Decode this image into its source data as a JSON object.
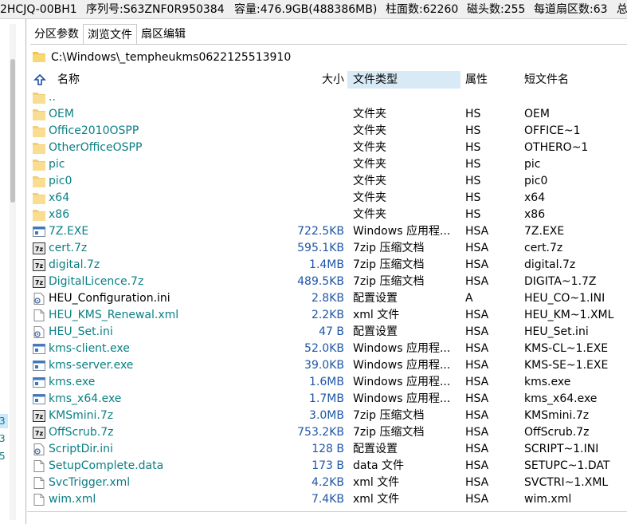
{
  "disk_info": {
    "model": "2HCJQ-00BH1",
    "serial": "序列号:S63ZNF0R950384",
    "capacity": "容量:476.9GB(488386MB)",
    "cylinders": "柱面数:62260",
    "heads": "磁头数:255",
    "sectors": "每道扇区数:63",
    "more": "总"
  },
  "left_pane_fragments": [
    "3",
    "3",
    "5"
  ],
  "tabs": [
    {
      "label": "分区参数",
      "active": false
    },
    {
      "label": "浏览文件",
      "active": true
    },
    {
      "label": "扇区编辑",
      "active": false
    }
  ],
  "path": "C:\\Windows\\_tempheukms0622125513910",
  "columns": {
    "name": "名称",
    "size": "大小",
    "type": "文件类型",
    "attr": "属性",
    "short": "短文件名"
  },
  "colors": {
    "name_text": "#0a7f84",
    "size_text": "#1d56a6",
    "sorted_header_bg": "#d9eaf7",
    "folder": "#f5d27a"
  },
  "files": [
    {
      "icon": "parent-folder-icon",
      "name": "..",
      "size": "",
      "type": "",
      "attr": "",
      "short": ""
    },
    {
      "icon": "folder-icon",
      "name": "OEM",
      "size": "",
      "type": "文件夹",
      "attr": "HS",
      "short": "OEM"
    },
    {
      "icon": "folder-icon",
      "name": "Office2010OSPP",
      "size": "",
      "type": "文件夹",
      "attr": "HS",
      "short": "OFFICE~1"
    },
    {
      "icon": "folder-icon",
      "name": "OtherOfficeOSPP",
      "size": "",
      "type": "文件夹",
      "attr": "HS",
      "short": "OTHERO~1"
    },
    {
      "icon": "folder-icon",
      "name": "pic",
      "size": "",
      "type": "文件夹",
      "attr": "HS",
      "short": "pic"
    },
    {
      "icon": "folder-icon",
      "name": "pic0",
      "size": "",
      "type": "文件夹",
      "attr": "HS",
      "short": "pic0"
    },
    {
      "icon": "folder-icon",
      "name": "x64",
      "size": "",
      "type": "文件夹",
      "attr": "HS",
      "short": "x64"
    },
    {
      "icon": "folder-icon",
      "name": "x86",
      "size": "",
      "type": "文件夹",
      "attr": "HS",
      "short": "x86"
    },
    {
      "icon": "exe-icon",
      "name": "7Z.EXE",
      "size": "722.5KB",
      "type": "Windows 应用程...",
      "attr": "HSA",
      "short": "7Z.EXE"
    },
    {
      "icon": "7z-archive-icon",
      "name": "cert.7z",
      "size": "595.1KB",
      "type": "7zip 压缩文档",
      "attr": "HSA",
      "short": "cert.7z"
    },
    {
      "icon": "7z-archive-icon",
      "name": "digital.7z",
      "size": "1.4MB",
      "type": "7zip 压缩文档",
      "attr": "HSA",
      "short": "digital.7z"
    },
    {
      "icon": "7z-archive-icon",
      "name": "DigitalLicence.7z",
      "size": "489.5KB",
      "type": "7zip 压缩文档",
      "attr": "HSA",
      "short": "DIGITA~1.7Z"
    },
    {
      "icon": "ini-settings-icon",
      "name": "HEU_Configuration.ini",
      "size": "2.8KB",
      "type": "配置设置",
      "attr": "A",
      "short": "HEU_CO~1.INI",
      "plain": true
    },
    {
      "icon": "file-icon",
      "name": "HEU_KMS_Renewal.xml",
      "size": "2.2KB",
      "type": "xml 文件",
      "attr": "HSA",
      "short": "HEU_KM~1.XML"
    },
    {
      "icon": "ini-settings-icon",
      "name": "HEU_Set.ini",
      "size": "47 B",
      "type": "配置设置",
      "attr": "HSA",
      "short": "HEU_Set.ini"
    },
    {
      "icon": "exe-icon",
      "name": "kms-client.exe",
      "size": "52.0KB",
      "type": "Windows 应用程...",
      "attr": "HSA",
      "short": "KMS-CL~1.EXE"
    },
    {
      "icon": "exe-icon",
      "name": "kms-server.exe",
      "size": "39.0KB",
      "type": "Windows 应用程...",
      "attr": "HSA",
      "short": "KMS-SE~1.EXE"
    },
    {
      "icon": "exe-icon",
      "name": "kms.exe",
      "size": "1.6MB",
      "type": "Windows 应用程...",
      "attr": "HSA",
      "short": "kms.exe"
    },
    {
      "icon": "exe-icon",
      "name": "kms_x64.exe",
      "size": "1.7MB",
      "type": "Windows 应用程...",
      "attr": "HSA",
      "short": "kms_x64.exe"
    },
    {
      "icon": "7z-archive-icon",
      "name": "KMSmini.7z",
      "size": "3.0MB",
      "type": "7zip 压缩文档",
      "attr": "HSA",
      "short": "KMSmini.7z"
    },
    {
      "icon": "7z-archive-icon",
      "name": "OffScrub.7z",
      "size": "753.2KB",
      "type": "7zip 压缩文档",
      "attr": "HSA",
      "short": "OffScrub.7z"
    },
    {
      "icon": "ini-settings-icon",
      "name": "ScriptDir.ini",
      "size": "128 B",
      "type": "配置设置",
      "attr": "HSA",
      "short": "SCRIPT~1.INI"
    },
    {
      "icon": "file-icon",
      "name": "SetupComplete.data",
      "size": "173 B",
      "type": "data 文件",
      "attr": "HSA",
      "short": "SETUPC~1.DAT"
    },
    {
      "icon": "file-icon",
      "name": "SvcTrigger.xml",
      "size": "4.2KB",
      "type": "xml 文件",
      "attr": "HSA",
      "short": "SVCTRI~1.XML"
    },
    {
      "icon": "file-icon",
      "name": "wim.xml",
      "size": "7.4KB",
      "type": "xml 文件",
      "attr": "HSA",
      "short": "wim.xml"
    }
  ]
}
